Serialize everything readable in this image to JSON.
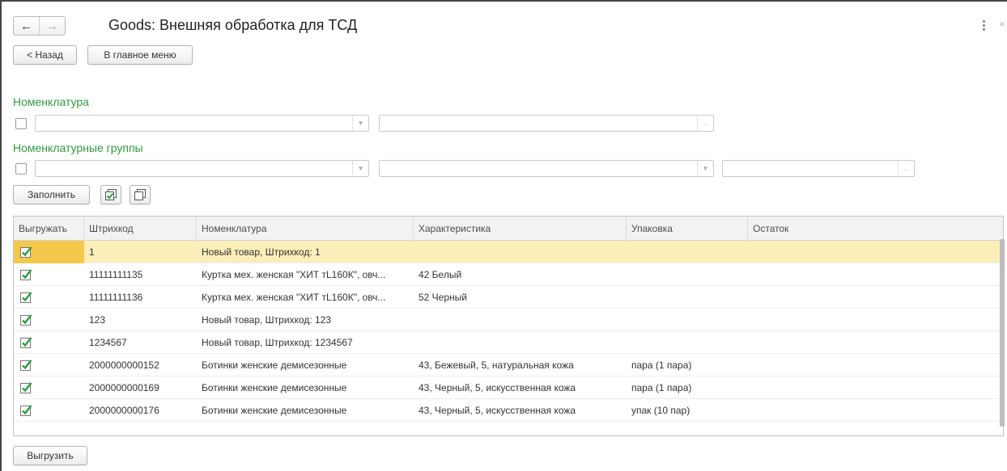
{
  "window": {
    "title": "Goods: Внешняя обработка для ТСД"
  },
  "nav": {
    "back_glyph": "←",
    "forward_glyph": "→",
    "menu_glyph": "⋮",
    "close_glyph": "×"
  },
  "toolbar": {
    "back_button": "< Назад",
    "main_menu_button": "В главное меню"
  },
  "filters": {
    "nomenclature_label": "Номенклатура",
    "nomenclature_groups_label": "Номенклатурные группы"
  },
  "actions": {
    "fill_button": "Заполнить",
    "export_button": "Выгрузить"
  },
  "icons": {
    "check_all": "check-all-icon",
    "uncheck_all": "uncheck-all-icon",
    "dropdown": "chevron-down-icon",
    "select": "ellipsis-icon"
  },
  "colors": {
    "group_label": "#2f9a41",
    "check_mark": "#2e9c43",
    "selected_row": "#fbeeb8",
    "selected_cell": "#f4c84b"
  },
  "table": {
    "columns": [
      "Выгружать",
      "Штрихкод",
      "Номенклатура",
      "Характеристика",
      "Упаковка",
      "Остаток"
    ],
    "rows": [
      {
        "export": true,
        "barcode": "1",
        "item": "Новый товар, Штрихкод: 1",
        "characteristic": "",
        "package": "",
        "remainder": ""
      },
      {
        "export": true,
        "barcode": "11111111135",
        "item": "Куртка мех. женская \"ХИТ тL160К\", овч...",
        "characteristic": "42 Белый",
        "package": "",
        "remainder": ""
      },
      {
        "export": true,
        "barcode": "11111111136",
        "item": "Куртка мех. женская \"ХИТ тL160К\", овч...",
        "characteristic": "52 Черный",
        "package": "",
        "remainder": ""
      },
      {
        "export": true,
        "barcode": "123",
        "item": "Новый товар, Штрихкод: 123",
        "characteristic": "",
        "package": "",
        "remainder": ""
      },
      {
        "export": true,
        "barcode": "1234567",
        "item": "Новый товар, Штрихкод: 1234567",
        "characteristic": "",
        "package": "",
        "remainder": ""
      },
      {
        "export": true,
        "barcode": "2000000000152",
        "item": "Ботинки женские демисезонные",
        "characteristic": "43, Бежевый, 5, натуральная кожа",
        "package": "пара (1 пара)",
        "remainder": ""
      },
      {
        "export": true,
        "barcode": "2000000000169",
        "item": "Ботинки женские демисезонные",
        "characteristic": "43, Черный, 5, искусственная кожа",
        "package": "пара (1 пара)",
        "remainder": ""
      },
      {
        "export": true,
        "barcode": "2000000000176",
        "item": "Ботинки женские демисезонные",
        "characteristic": "43, Черный, 5, искусственная кожа",
        "package": "упак (10 пар)",
        "remainder": ""
      }
    ]
  }
}
